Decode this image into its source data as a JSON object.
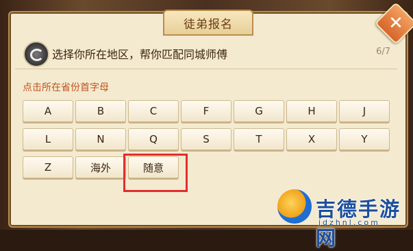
{
  "dialog": {
    "title": "徒弟报名",
    "close_label": "✕",
    "question": "选择你所在地区，帮你匹配同城师傅",
    "progress": "6/7",
    "hint": "点击所在省份首字母",
    "keys": [
      "A",
      "B",
      "C",
      "F",
      "G",
      "H",
      "J",
      "L",
      "N",
      "Q",
      "S",
      "T",
      "X",
      "Y",
      "Z",
      "海外",
      "随意"
    ]
  },
  "watermark": {
    "text": "吉德手游网",
    "url": "jdzhnl.com"
  },
  "colors": {
    "highlight": "#e22d2d",
    "hint": "#c0531f",
    "close_button": "#e07a3a"
  }
}
